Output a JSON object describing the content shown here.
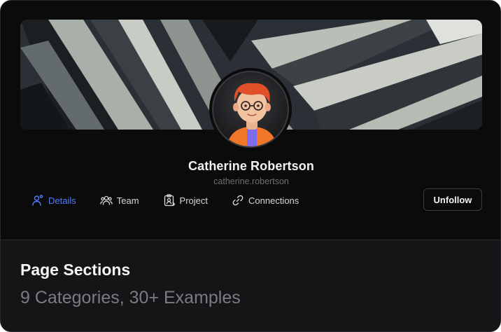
{
  "profile": {
    "name": "Catherine Robertson",
    "handle": "catherine.robertson"
  },
  "tabs": [
    {
      "label": "Details",
      "icon": "user-icon",
      "active": true
    },
    {
      "label": "Team",
      "icon": "users-icon",
      "active": false
    },
    {
      "label": "Project",
      "icon": "clipboard-icon",
      "active": false
    },
    {
      "label": "Connections",
      "icon": "link-icon",
      "active": false
    }
  ],
  "actions": {
    "unfollow_label": "Unfollow"
  },
  "footer": {
    "title": "Page Sections",
    "subtitle": "9 Categories, 30+ Examples"
  },
  "colors": {
    "accent": "#4d7cff",
    "background": "#0b0b0c",
    "panel": "#151517"
  }
}
